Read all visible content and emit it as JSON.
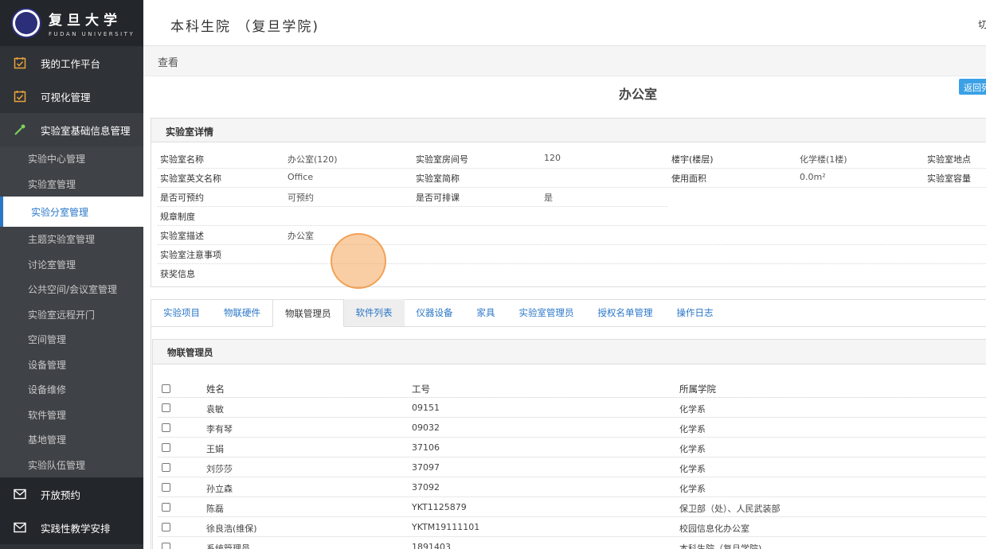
{
  "brand": {
    "cn": "复旦大学",
    "en": "FUDAN UNIVERSITY"
  },
  "header": {
    "title": "本科生院 （复旦学院)",
    "cut_text": "切"
  },
  "breadcrumb": "查看",
  "page_title": "办公室",
  "return_button": "返回列表",
  "sidebar": {
    "main_items": [
      {
        "label": "我的工作平台",
        "icon": "calendar-check-icon"
      },
      {
        "label": "可视化管理",
        "icon": "calendar-check-icon"
      },
      {
        "label": "实验室基础信息管理",
        "icon": "pipette-icon"
      }
    ],
    "sub_items": [
      "实验中心管理",
      "实验室管理",
      "实验分室管理",
      "主题实验室管理",
      "讨论室管理",
      "公共空间/会议室管理",
      "实验室远程开门",
      "空间管理",
      "设备管理",
      "设备维修",
      "软件管理",
      "基地管理",
      "实验队伍管理"
    ],
    "bottom_items": [
      {
        "label": "开放预约",
        "icon": "envelope-icon"
      },
      {
        "label": "实践性教学安排",
        "icon": "envelope-icon"
      }
    ]
  },
  "details": {
    "title": "实验室详情",
    "rows": [
      [
        {
          "k": "实验室名称",
          "v": "办公室(120)"
        },
        {
          "k": "实验室房间号",
          "v": "120"
        },
        {
          "k": "楼宇(楼层)",
          "v": "化学楼(1楼)"
        },
        {
          "k": "实验室地点",
          "v": ""
        }
      ],
      [
        {
          "k": "实验室英文名称",
          "v": "Office"
        },
        {
          "k": "实验室简称",
          "v": ""
        },
        {
          "k": "使用面积",
          "v": "0.0m²"
        },
        {
          "k": "实验室容量",
          "v": ""
        }
      ],
      [
        {
          "k": "是否可预约",
          "v": "可预约"
        },
        {
          "k": "是否可排课",
          "v": "是"
        }
      ],
      [
        {
          "k": "规章制度",
          "v": ""
        }
      ],
      [
        {
          "k": "实验室描述",
          "v": "办公室"
        }
      ],
      [
        {
          "k": "实验室注意事项",
          "v": ""
        }
      ],
      [
        {
          "k": "获奖信息",
          "v": ""
        }
      ]
    ]
  },
  "tabs": [
    "实验项目",
    "物联硬件",
    "物联管理员",
    "软件列表",
    "仪器设备",
    "家具",
    "实验室管理员",
    "授权名单管理",
    "操作日志"
  ],
  "active_tab": "物联管理员",
  "table": {
    "title": "物联管理员",
    "headers": [
      "姓名",
      "工号",
      "所属学院"
    ],
    "rows": [
      [
        "袁敏",
        "09151",
        "化学系"
      ],
      [
        "李有琴",
        "09032",
        "化学系"
      ],
      [
        "王娟",
        "37106",
        "化学系"
      ],
      [
        "刘莎莎",
        "37097",
        "化学系"
      ],
      [
        "孙立森",
        "37092",
        "化学系"
      ],
      [
        "陈磊",
        "YKT1125879",
        "保卫部（处）、人民武装部"
      ],
      [
        "徐良浩(维保)",
        "YKTM19111101",
        "校园信息化办公室"
      ],
      [
        "系统管理员",
        "1891403",
        "本科生院（复旦学院)"
      ]
    ]
  }
}
